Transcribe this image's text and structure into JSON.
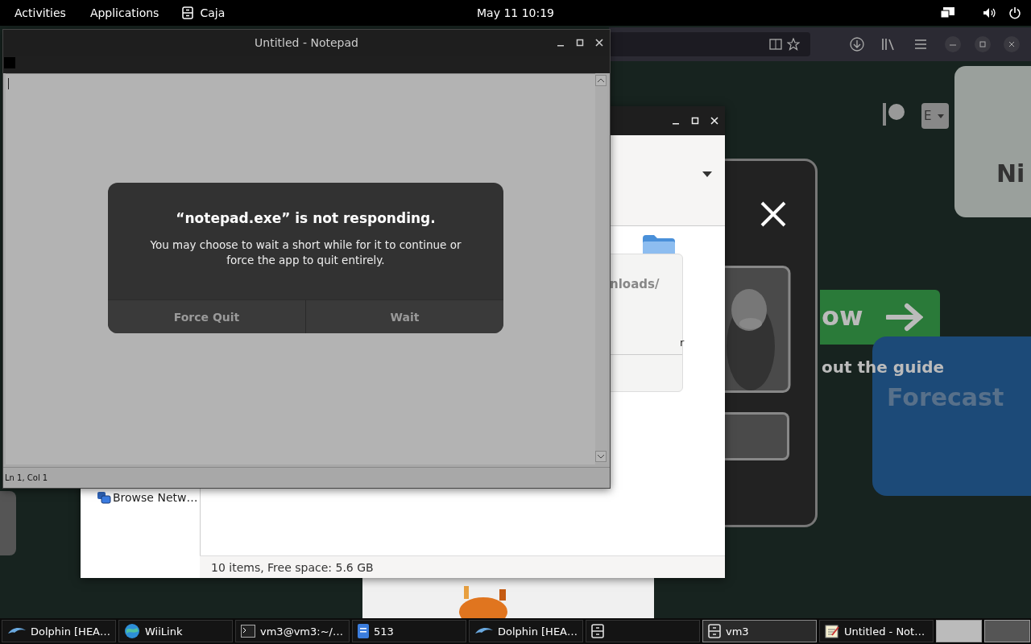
{
  "top_bar": {
    "activities": "Activities",
    "applications": "Applications",
    "app_menu": "Caja",
    "clock": "May 11  10:19"
  },
  "browser": {
    "content": {
      "card_text": "Ni",
      "language_menu": "E",
      "button_text": "ow",
      "guide_text": "out the guide",
      "forecast_text": "Forecast"
    }
  },
  "file_manager": {
    "path_fragment": "nloads/",
    "label_fragment": "r",
    "sidebar_items": [
      {
        "label": "Browse Netw…"
      }
    ],
    "status": "10 items, Free space: 5.6 GB"
  },
  "notepad": {
    "title": "Untitled - Notepad",
    "status": "Ln 1, Col 1"
  },
  "dialog": {
    "title": "“notepad.exe” is not responding.",
    "message": "You may choose to wait a short while for it to continue or force the app to quit entirely.",
    "buttons": [
      "Force Quit",
      "Wait"
    ]
  },
  "taskbar": {
    "items": [
      {
        "kind": "dolphin",
        "label": "Dolphin [HEA…",
        "selected": false
      },
      {
        "kind": "globe",
        "label": "WiiLink",
        "selected": false
      },
      {
        "kind": "terminal",
        "label": "vm3@vm3:~/…",
        "selected": false
      },
      {
        "kind": "document",
        "label": "513",
        "selected": false
      },
      {
        "kind": "dolphin",
        "label": "Dolphin [HEA…",
        "selected": false
      },
      {
        "kind": "cabinet",
        "selected": false
      },
      {
        "kind": "cabinet",
        "label": "vm3",
        "selected": true
      },
      {
        "kind": "notepad",
        "label": "Untitled - Not…",
        "selected": false
      }
    ],
    "workspaces": [
      {
        "selected": true
      },
      {
        "selected": false
      }
    ]
  }
}
